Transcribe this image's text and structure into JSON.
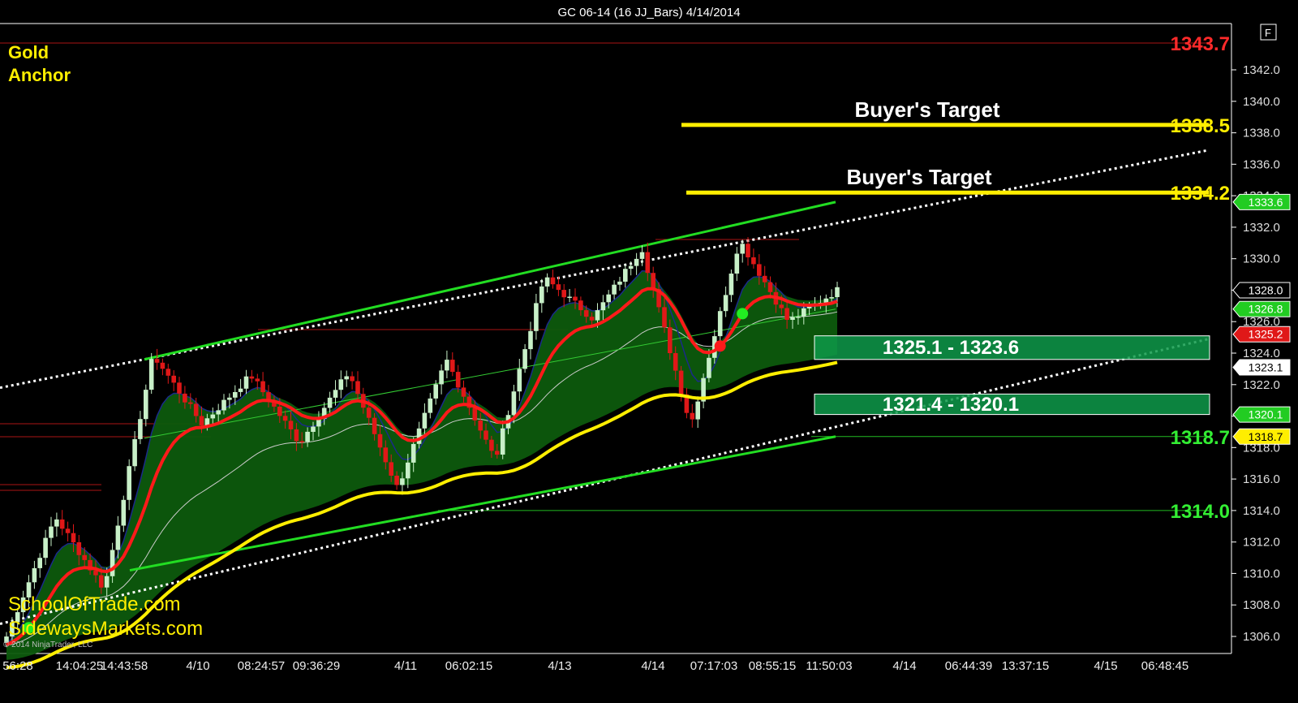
{
  "chart_title": "GC 06-14 (16 JJ_Bars)  4/14/2014",
  "corner_label": "F",
  "watermark": {
    "line1": "Gold",
    "line2": "Anchor"
  },
  "branding": {
    "line1": "SchoolOfTrade.com",
    "line2": "SidewaysMarkets.com",
    "copyright": "© 2014 NinjaTrader, LLC"
  },
  "colors": {
    "background": "#000000",
    "up_bar": "#c8f0c8",
    "down_bar": "#e01818",
    "ema_red": "#ff1a1a",
    "band_fill": "#0d5a0d",
    "yellow": "#ffee00",
    "green_line": "#22dd22",
    "target_label": "#ffffff"
  },
  "chart_data": {
    "type": "candlestick",
    "ylim": [
      1304.6,
      1344.5
    ],
    "y_ticks": [
      "1306.0",
      "1308.0",
      "1310.0",
      "1312.0",
      "1314.0",
      "1316.0",
      "1318.0",
      "1320.0",
      "1322.0",
      "1324.0",
      "1326.0",
      "1328.0",
      "1330.0",
      "1332.0",
      "1334.0",
      "1336.0",
      "1338.0",
      "1340.0",
      "1342.0"
    ],
    "x_labels": [
      "56:28",
      "14:04:25",
      "14:43:58",
      "4/10",
      "08:24:57",
      "09:36:29",
      "4/11",
      "06:02:15",
      "4/13",
      "4/14",
      "07:17:03",
      "08:55:15",
      "11:50:03",
      "4/14",
      "06:44:39",
      "13:37:15",
      "4/15",
      "06:48:45"
    ],
    "price_path": [
      1306.0,
      1313.6,
      1309.0,
      1323.9,
      1319.5,
      1322.6,
      1318.3,
      1322.8,
      1315.4,
      1323.6,
      1317.2,
      1328.8,
      1326.2,
      1330.7,
      1319.4,
      1331.2,
      1326.0,
      1328.0
    ],
    "levels": [
      {
        "label": "1343.7",
        "value": 1343.7,
        "color": "#ff2a2a"
      },
      {
        "label": "1338.5",
        "value": 1338.5,
        "color": "#ffee00",
        "annotation": "Buyer's Target"
      },
      {
        "label": "1334.2",
        "value": 1334.2,
        "color": "#ffee00",
        "annotation": "Buyer's Target"
      },
      {
        "label": "1318.7",
        "value": 1318.7,
        "color": "#33ee33"
      },
      {
        "label": "1314.0",
        "value": 1314.0,
        "color": "#33ee33"
      }
    ],
    "zones": [
      {
        "label": "1325.1 - 1323.6",
        "high": 1325.1,
        "low": 1323.6
      },
      {
        "label": "1321.4 - 1320.1",
        "high": 1321.4,
        "low": 1320.1
      }
    ],
    "price_tags": [
      {
        "label": "1333.6",
        "value": 1333.6,
        "bg": "#22cc22",
        "fg": "#ffffff"
      },
      {
        "label": "1328.0",
        "value": 1328.0,
        "bg": "#000000",
        "fg": "#ffffff"
      },
      {
        "label": "1326.8",
        "value": 1326.8,
        "bg": "#22cc22",
        "fg": "#ffffff"
      },
      {
        "label": "1325.2",
        "value": 1325.2,
        "bg": "#e01818",
        "fg": "#ffffff"
      },
      {
        "label": "1323.1",
        "value": 1323.1,
        "bg": "#ffffff",
        "fg": "#000000"
      },
      {
        "label": "1320.1",
        "value": 1320.1,
        "bg": "#22cc22",
        "fg": "#ffffff"
      },
      {
        "label": "1318.7",
        "value": 1318.7,
        "bg": "#ffee00",
        "fg": "#000000"
      }
    ]
  }
}
